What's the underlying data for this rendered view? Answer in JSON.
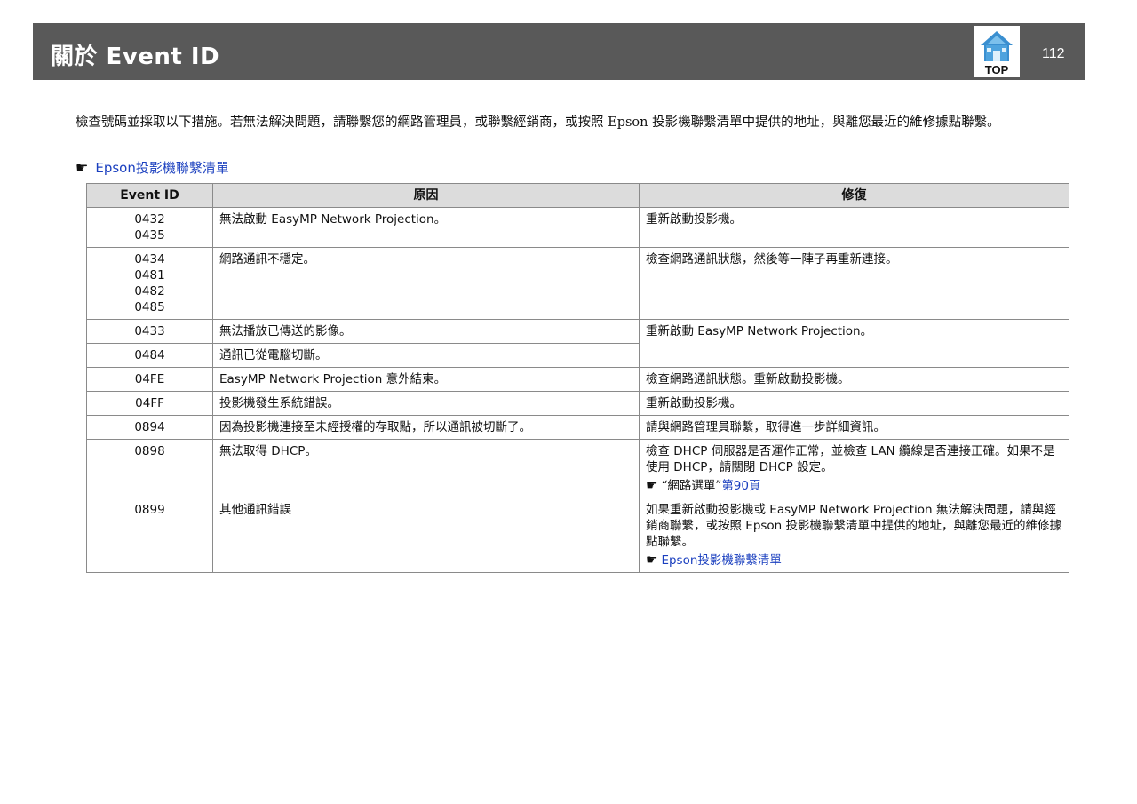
{
  "header": {
    "title": "關於 Event ID",
    "top_button_label": "TOP",
    "page_number": "112"
  },
  "intro": {
    "text": "檢查號碼並採取以下措施。若無法解決問題，請聯繫您的網路管理員，或聯繫經銷商，或按照 Epson 投影機聯繫清單中提供的地址，與離您最近的維修據點聯繫。",
    "link_icon": "☛",
    "link_text": "Epson投影機聯繫清單"
  },
  "table": {
    "headers": [
      "Event ID",
      "原因",
      "修復"
    ],
    "rows": [
      {
        "ids": [
          "0432",
          "0435"
        ],
        "cause": "無法啟動 EasyMP Network Projection。",
        "fix": "重新啟動投影機。"
      },
      {
        "ids": [
          "0434",
          "0481",
          "0482",
          "0485"
        ],
        "cause": "網路通訊不穩定。",
        "fix": "檢查網路通訊狀態，然後等一陣子再重新連接。"
      },
      {
        "ids": [
          "0433"
        ],
        "cause": "無法播放已傳送的影像。",
        "fix": "重新啟動 EasyMP Network Projection。"
      },
      {
        "ids": [
          "0484"
        ],
        "cause": "通訊已從電腦切斷。"
      },
      {
        "ids": [
          "04FE"
        ],
        "cause": "EasyMP Network Projection 意外結束。",
        "fix": "檢查網路通訊狀態。重新啟動投影機。"
      },
      {
        "ids": [
          "04FF"
        ],
        "cause": "投影機發生系統錯誤。",
        "fix": "重新啟動投影機。"
      },
      {
        "ids": [
          "0894"
        ],
        "cause": "因為投影機連接至未經授權的存取點，所以通訊被切斷了。",
        "fix": "請與網路管理員聯繫，取得進一步詳細資訊。"
      },
      {
        "ids": [
          "0898"
        ],
        "cause": "無法取得 DHCP。",
        "fix": "檢查 DHCP 伺服器是否運作正常，並檢查 LAN 纜線是否連接正確。如果不是使用 DHCP，請關閉 DHCP 設定。",
        "ref_quote": "“網路選單”",
        "ref_link": "第90頁"
      },
      {
        "ids": [
          "0899"
        ],
        "cause": "其他通訊錯誤",
        "fix": "如果重新啟動投影機或 EasyMP Network Projection 無法解決問題，請與經銷商聯繫，或按照 Epson 投影機聯繫清單中提供的地址，與離您最近的維修據點聯繫。",
        "ref_link": "Epson投影機聯繫清單"
      }
    ]
  },
  "colors": {
    "header_bg": "#595959",
    "table_header_bg": "#dcdcdc",
    "link": "#1a3fbf",
    "top_icon": "#3a8fd0"
  }
}
